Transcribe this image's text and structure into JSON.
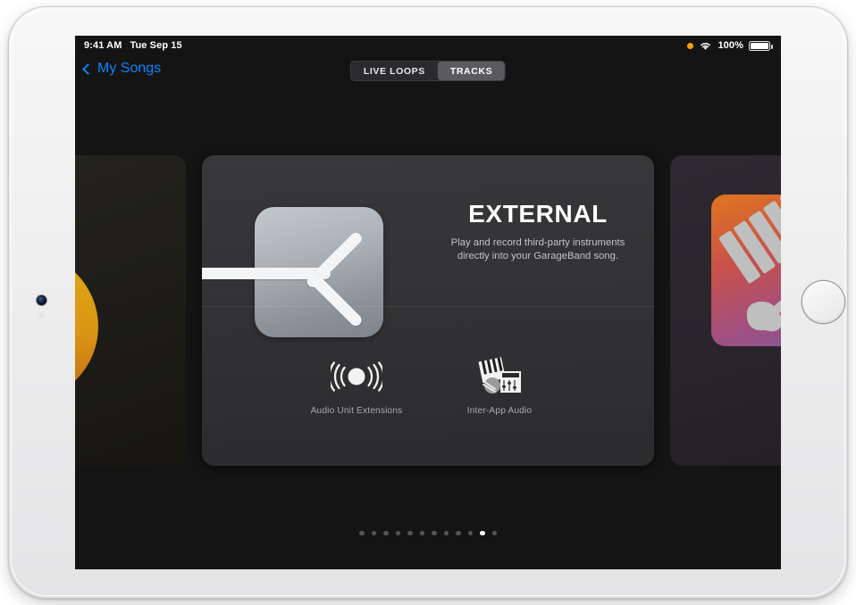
{
  "status_bar": {
    "time": "9:41 AM",
    "date": "Tue Sep 15",
    "recording_indicator": "orange-dot-icon",
    "wifi_icon": "wifi-icon",
    "battery_percent": "100%",
    "battery_icon": "battery-full-icon"
  },
  "nav": {
    "back_label": "My Songs",
    "back_icon": "chevron-left-icon",
    "segments": [
      {
        "label": "LIVE LOOPS",
        "selected": false
      },
      {
        "label": "TRACKS",
        "selected": true
      }
    ]
  },
  "carousel": {
    "left_card": {
      "name": "drummer-card",
      "icon": "drummer-silhouette-icon"
    },
    "center_card": {
      "title": "EXTERNAL",
      "subtitle": "Play and record third-party instruments directly into your GarageBand song.",
      "hero_icon": "arrow-right-tile-icon",
      "options": [
        {
          "label": "Audio Unit Extensions",
          "icon": "audio-waves-icon"
        },
        {
          "label": "Inter-App Audio",
          "icon": "keyboard-mixer-icon"
        }
      ]
    },
    "right_card": {
      "name": "keyboard-guitar-card",
      "icon": "keyboard-guitar-icon"
    }
  },
  "page_indicator": {
    "total": 12,
    "active_index": 10
  },
  "colors": {
    "accent_blue": "#0a84ff",
    "screen_background": "#141414",
    "card_background": "#333335",
    "recording_orange": "#ff9f0a",
    "drummer_gold": "#d89515",
    "instrument_gradient_start": "#e0761f",
    "instrument_gradient_end": "#7d5a9e"
  },
  "device": {
    "camera_icon": "front-camera-icon",
    "sensor_icon": "ambient-light-sensor-icon",
    "home_button": "home-button"
  }
}
